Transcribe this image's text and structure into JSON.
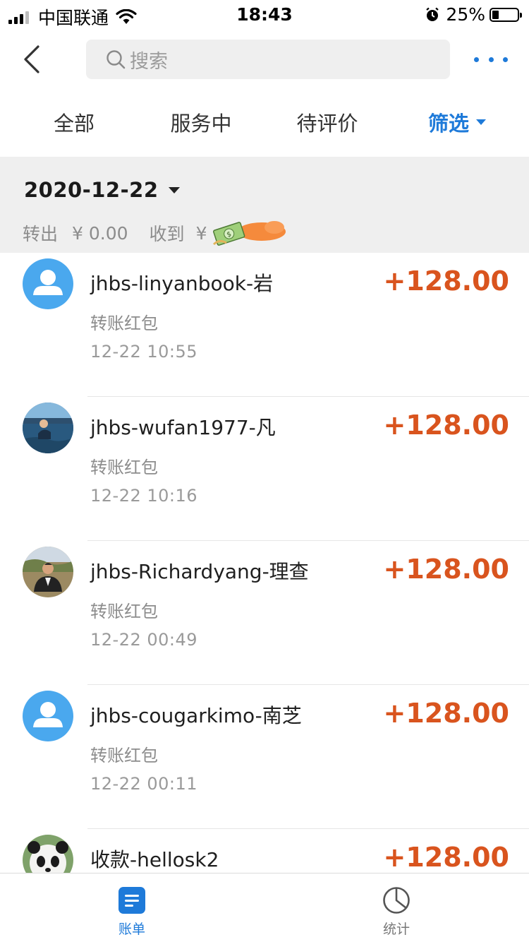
{
  "status_bar": {
    "carrier": "中国联通",
    "time": "18:43",
    "battery": "25%",
    "battery_level": 0.25
  },
  "nav": {
    "search_placeholder": "搜索"
  },
  "tabs": [
    {
      "label": "全部"
    },
    {
      "label": "服务中"
    },
    {
      "label": "待评价"
    },
    {
      "label": "筛选"
    }
  ],
  "date_section": {
    "date": "2020-12-22",
    "out_label": "转出",
    "out_amount": "¥ 0.00",
    "in_label": "收到",
    "in_currency": "¥"
  },
  "transactions": [
    {
      "name": "jhbs-linyanbook-岩",
      "type": "转账红包",
      "time": "12-22  10:55",
      "amount": "+128.00",
      "avatar": "default"
    },
    {
      "name": "jhbs-wufan1977-凡",
      "type": "转账红包",
      "time": "12-22  10:16",
      "amount": "+128.00",
      "avatar": "photo-swimmer"
    },
    {
      "name": "jhbs-Richardyang-理查",
      "type": "转账红包",
      "time": "12-22  00:49",
      "amount": "+128.00",
      "avatar": "photo-man"
    },
    {
      "name": "jhbs-cougarkimo-南芝",
      "type": "转账红包",
      "time": "12-22  00:11",
      "amount": "+128.00",
      "avatar": "default"
    },
    {
      "name": "收款-hellosk2",
      "type": "",
      "time": "",
      "amount": "+128.00",
      "avatar": "photo-panda"
    }
  ],
  "tabbar": {
    "bill_label": "账单",
    "stats_label": "统计"
  },
  "colors": {
    "accent": "#1e7ad9",
    "amount": "#d9541e",
    "avatar_default": "#4aa8ee"
  }
}
